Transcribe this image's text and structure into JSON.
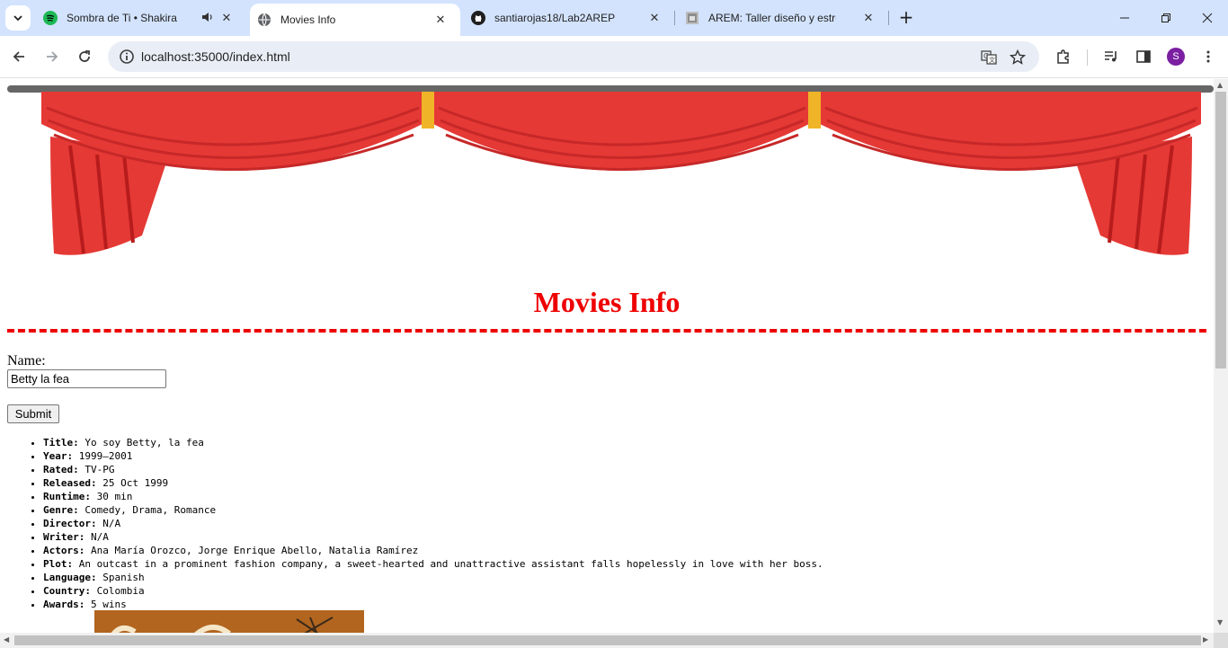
{
  "browser": {
    "tabs": [
      {
        "title": "Sombra de Ti • Shakira",
        "favicon": "spotify-icon",
        "audio": true
      },
      {
        "title": "Movies Info",
        "favicon": "globe-icon",
        "active": true
      },
      {
        "title": "santiarojas18/Lab2AREP",
        "favicon": "github-icon"
      },
      {
        "title": "AREM: Taller diseño y estructura",
        "favicon": "document-icon"
      }
    ],
    "close_glyph": "✕",
    "new_tab_glyph": "+",
    "url": "localhost:35000/index.html",
    "profile_initial": "S",
    "accent": "#7b1fa2"
  },
  "page": {
    "heading": "Movies Info",
    "form": {
      "name_label": "Name:",
      "name_value": "Betty la fea",
      "submit_label": "Submit"
    },
    "details": [
      {
        "key": "Title:",
        "value": " Yo soy Betty, la fea"
      },
      {
        "key": "Year:",
        "value": " 1999–2001"
      },
      {
        "key": "Rated:",
        "value": " TV-PG"
      },
      {
        "key": "Released:",
        "value": " 25 Oct 1999"
      },
      {
        "key": "Runtime:",
        "value": " 30 min"
      },
      {
        "key": "Genre:",
        "value": " Comedy, Drama, Romance"
      },
      {
        "key": "Director:",
        "value": " N/A"
      },
      {
        "key": "Writer:",
        "value": " N/A"
      },
      {
        "key": "Actors:",
        "value": " Ana María Orozco, Jorge Enrique Abello, Natalia Ramírez"
      },
      {
        "key": "Plot:",
        "value": " An outcast in a prominent fashion company, a sweet-hearted and unattractive assistant falls hopelessly in love with her boss."
      },
      {
        "key": "Language:",
        "value": " Spanish"
      },
      {
        "key": "Country:",
        "value": " Colombia"
      },
      {
        "key": "Awards:",
        "value": " 5 wins"
      }
    ],
    "colors": {
      "heading": "#ee0000",
      "curtain": "#e53935",
      "curtain_dark": "#b71c1c",
      "rod": "#666666",
      "tieback": "#f0b429"
    }
  }
}
